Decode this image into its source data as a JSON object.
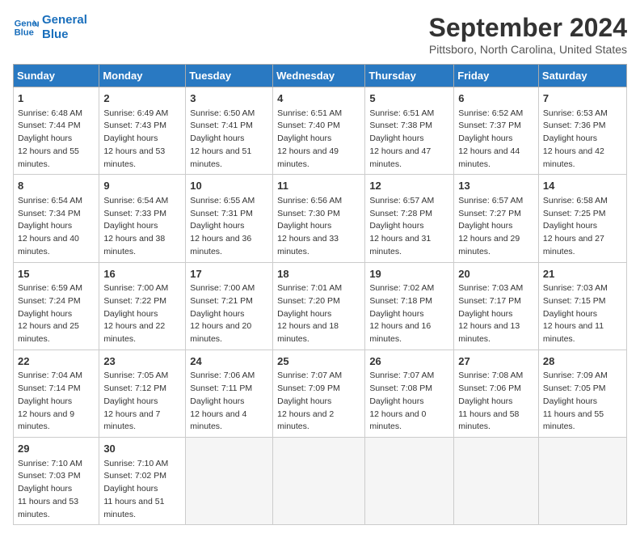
{
  "header": {
    "logo_line1": "General",
    "logo_line2": "Blue",
    "month": "September 2024",
    "location": "Pittsboro, North Carolina, United States"
  },
  "days_of_week": [
    "Sunday",
    "Monday",
    "Tuesday",
    "Wednesday",
    "Thursday",
    "Friday",
    "Saturday"
  ],
  "weeks": [
    [
      {
        "day": 1,
        "rise": "6:48 AM",
        "set": "7:44 PM",
        "daylight": "12 hours and 55 minutes."
      },
      {
        "day": 2,
        "rise": "6:49 AM",
        "set": "7:43 PM",
        "daylight": "12 hours and 53 minutes."
      },
      {
        "day": 3,
        "rise": "6:50 AM",
        "set": "7:41 PM",
        "daylight": "12 hours and 51 minutes."
      },
      {
        "day": 4,
        "rise": "6:51 AM",
        "set": "7:40 PM",
        "daylight": "12 hours and 49 minutes."
      },
      {
        "day": 5,
        "rise": "6:51 AM",
        "set": "7:38 PM",
        "daylight": "12 hours and 47 minutes."
      },
      {
        "day": 6,
        "rise": "6:52 AM",
        "set": "7:37 PM",
        "daylight": "12 hours and 44 minutes."
      },
      {
        "day": 7,
        "rise": "6:53 AM",
        "set": "7:36 PM",
        "daylight": "12 hours and 42 minutes."
      }
    ],
    [
      {
        "day": 8,
        "rise": "6:54 AM",
        "set": "7:34 PM",
        "daylight": "12 hours and 40 minutes."
      },
      {
        "day": 9,
        "rise": "6:54 AM",
        "set": "7:33 PM",
        "daylight": "12 hours and 38 minutes."
      },
      {
        "day": 10,
        "rise": "6:55 AM",
        "set": "7:31 PM",
        "daylight": "12 hours and 36 minutes."
      },
      {
        "day": 11,
        "rise": "6:56 AM",
        "set": "7:30 PM",
        "daylight": "12 hours and 33 minutes."
      },
      {
        "day": 12,
        "rise": "6:57 AM",
        "set": "7:28 PM",
        "daylight": "12 hours and 31 minutes."
      },
      {
        "day": 13,
        "rise": "6:57 AM",
        "set": "7:27 PM",
        "daylight": "12 hours and 29 minutes."
      },
      {
        "day": 14,
        "rise": "6:58 AM",
        "set": "7:25 PM",
        "daylight": "12 hours and 27 minutes."
      }
    ],
    [
      {
        "day": 15,
        "rise": "6:59 AM",
        "set": "7:24 PM",
        "daylight": "12 hours and 25 minutes."
      },
      {
        "day": 16,
        "rise": "7:00 AM",
        "set": "7:22 PM",
        "daylight": "12 hours and 22 minutes."
      },
      {
        "day": 17,
        "rise": "7:00 AM",
        "set": "7:21 PM",
        "daylight": "12 hours and 20 minutes."
      },
      {
        "day": 18,
        "rise": "7:01 AM",
        "set": "7:20 PM",
        "daylight": "12 hours and 18 minutes."
      },
      {
        "day": 19,
        "rise": "7:02 AM",
        "set": "7:18 PM",
        "daylight": "12 hours and 16 minutes."
      },
      {
        "day": 20,
        "rise": "7:03 AM",
        "set": "7:17 PM",
        "daylight": "12 hours and 13 minutes."
      },
      {
        "day": 21,
        "rise": "7:03 AM",
        "set": "7:15 PM",
        "daylight": "12 hours and 11 minutes."
      }
    ],
    [
      {
        "day": 22,
        "rise": "7:04 AM",
        "set": "7:14 PM",
        "daylight": "12 hours and 9 minutes."
      },
      {
        "day": 23,
        "rise": "7:05 AM",
        "set": "7:12 PM",
        "daylight": "12 hours and 7 minutes."
      },
      {
        "day": 24,
        "rise": "7:06 AM",
        "set": "7:11 PM",
        "daylight": "12 hours and 4 minutes."
      },
      {
        "day": 25,
        "rise": "7:07 AM",
        "set": "7:09 PM",
        "daylight": "12 hours and 2 minutes."
      },
      {
        "day": 26,
        "rise": "7:07 AM",
        "set": "7:08 PM",
        "daylight": "12 hours and 0 minutes."
      },
      {
        "day": 27,
        "rise": "7:08 AM",
        "set": "7:06 PM",
        "daylight": "11 hours and 58 minutes."
      },
      {
        "day": 28,
        "rise": "7:09 AM",
        "set": "7:05 PM",
        "daylight": "11 hours and 55 minutes."
      }
    ],
    [
      {
        "day": 29,
        "rise": "7:10 AM",
        "set": "7:03 PM",
        "daylight": "11 hours and 53 minutes."
      },
      {
        "day": 30,
        "rise": "7:10 AM",
        "set": "7:02 PM",
        "daylight": "11 hours and 51 minutes."
      },
      null,
      null,
      null,
      null,
      null
    ]
  ]
}
